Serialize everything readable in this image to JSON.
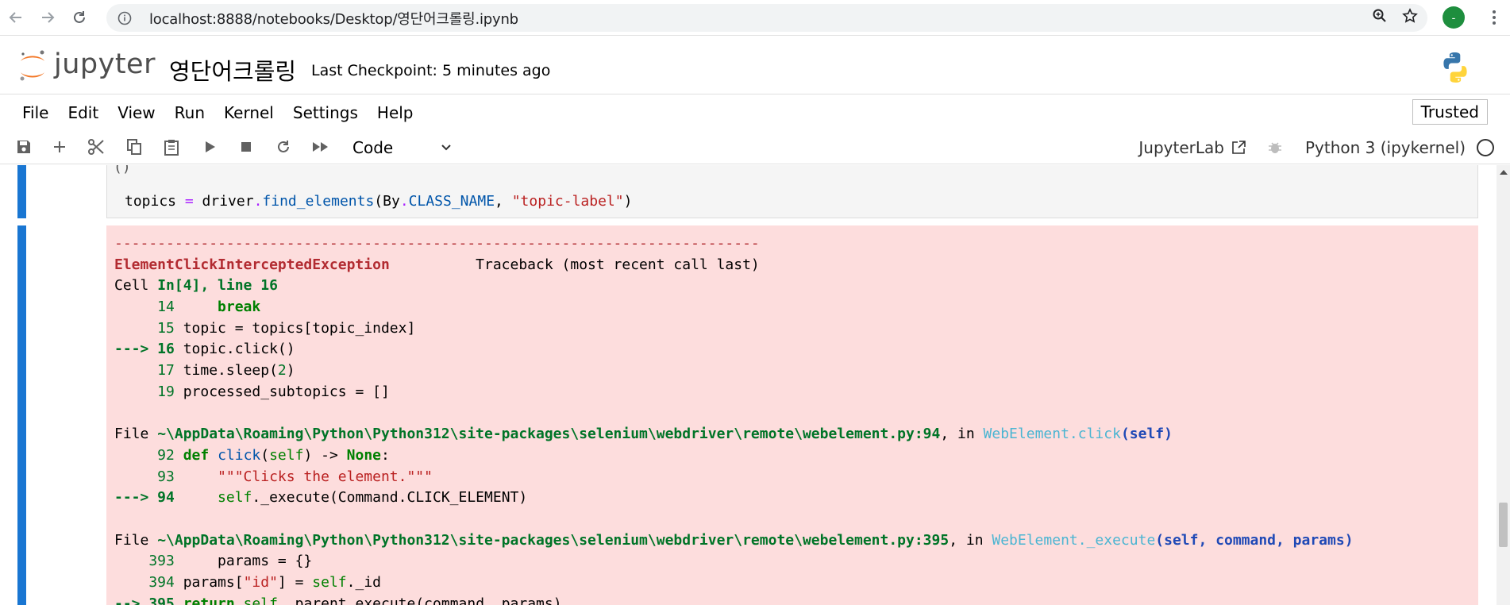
{
  "browser": {
    "url": "localhost:8888/notebooks/Desktop/영단어크롤링.ipynb",
    "profile_initial": "-",
    "icons": [
      "back-arrow-icon",
      "forward-arrow-icon",
      "reload-icon",
      "site-info-icon",
      "zoom-icon",
      "star-icon",
      "menu-icon"
    ]
  },
  "header": {
    "wordmark": "jupyter",
    "notebook_title": "영단어크롤링",
    "checkpoint": "Last Checkpoint: 5 minutes ago"
  },
  "menubar": {
    "items": [
      "File",
      "Edit",
      "View",
      "Run",
      "Kernel",
      "Settings",
      "Help"
    ],
    "trusted": "Trusted"
  },
  "toolbar": {
    "cell_type": "Code",
    "jupyterlab": "JupyterLab",
    "kernel": "Python 3 (ipykernel)",
    "icons": [
      "save-icon",
      "add-icon",
      "cut-icon",
      "copy-icon",
      "paste-icon",
      "run-icon",
      "stop-icon",
      "restart-icon",
      "fast-forward-icon"
    ]
  },
  "code_cell": {
    "partial_line": "     ()",
    "code_parts": [
      {
        "text": "topics ",
        "cls": ""
      },
      {
        "text": "=",
        "cls": "op"
      },
      {
        "text": " driver",
        "cls": ""
      },
      {
        "text": ".",
        "cls": "op"
      },
      {
        "text": "find_elements",
        "cls": "blue"
      },
      {
        "text": "(By",
        "cls": ""
      },
      {
        "text": ".",
        "cls": "op"
      },
      {
        "text": "CLASS_NAME",
        "cls": "blue"
      },
      {
        "text": ", ",
        "cls": ""
      },
      {
        "text": "\"topic-label\"",
        "cls": "str"
      },
      {
        "text": ")",
        "cls": ""
      }
    ]
  },
  "traceback": {
    "lines": [
      [
        {
          "t": "---------------------------------------------------------------------------",
          "c": "dashes"
        }
      ],
      [
        {
          "t": "ElementClickInterceptedException",
          "c": "red"
        },
        {
          "t": "          Traceback (most recent call last)",
          "c": ""
        }
      ],
      [
        {
          "t": "Cell ",
          "c": ""
        },
        {
          "t": "In[4], line 16",
          "c": "greenb"
        }
      ],
      [
        {
          "t": "     14",
          "c": "green"
        },
        {
          "t": "     ",
          "c": ""
        },
        {
          "t": "break",
          "c": "kw"
        }
      ],
      [
        {
          "t": "     15",
          "c": "green"
        },
        {
          "t": " topic ",
          "c": ""
        },
        {
          "t": "=",
          "c": ""
        },
        {
          "t": " topics[topic_index]",
          "c": ""
        }
      ],
      [
        {
          "t": "---> 16",
          "c": "greenb"
        },
        {
          "t": " topic",
          "c": ""
        },
        {
          "t": ".",
          "c": ""
        },
        {
          "t": "click()",
          "c": ""
        }
      ],
      [
        {
          "t": "     17",
          "c": "green"
        },
        {
          "t": " time",
          "c": ""
        },
        {
          "t": ".",
          "c": ""
        },
        {
          "t": "sleep(",
          "c": ""
        },
        {
          "t": "2",
          "c": "green"
        },
        {
          "t": ")",
          "c": ""
        }
      ],
      [
        {
          "t": "     19",
          "c": "green"
        },
        {
          "t": " processed_subtopics ",
          "c": ""
        },
        {
          "t": "=",
          "c": ""
        },
        {
          "t": " []",
          "c": ""
        }
      ],
      [
        {
          "t": "",
          "c": ""
        }
      ],
      [
        {
          "t": "File ",
          "c": ""
        },
        {
          "t": "~\\AppData\\Roaming\\Python\\Python312\\site-packages\\selenium\\webdriver\\remote\\webelement.py:94",
          "c": "greenb"
        },
        {
          "t": ", in ",
          "c": ""
        },
        {
          "t": "WebElement.click",
          "c": "cyan"
        },
        {
          "t": "(self)",
          "c": "blueb"
        }
      ],
      [
        {
          "t": "     92",
          "c": "green"
        },
        {
          "t": " ",
          "c": ""
        },
        {
          "t": "def",
          "c": "kw"
        },
        {
          "t": " ",
          "c": ""
        },
        {
          "t": "click",
          "c": "blue"
        },
        {
          "t": "(",
          "c": ""
        },
        {
          "t": "self",
          "c": "self"
        },
        {
          "t": ") ",
          "c": ""
        },
        {
          "t": "->",
          "c": ""
        },
        {
          "t": " ",
          "c": ""
        },
        {
          "t": "None",
          "c": "kw"
        },
        {
          "t": ":",
          "c": ""
        }
      ],
      [
        {
          "t": "     93",
          "c": "green"
        },
        {
          "t": "     ",
          "c": ""
        },
        {
          "t": "\"\"\"Clicks the element.\"\"\"",
          "c": "str"
        }
      ],
      [
        {
          "t": "---> 94",
          "c": "greenb"
        },
        {
          "t": "     ",
          "c": ""
        },
        {
          "t": "self",
          "c": "self"
        },
        {
          "t": ".",
          "c": ""
        },
        {
          "t": "_execute(Command",
          "c": ""
        },
        {
          "t": ".",
          "c": ""
        },
        {
          "t": "CLICK_ELEMENT)",
          "c": ""
        }
      ],
      [
        {
          "t": "",
          "c": ""
        }
      ],
      [
        {
          "t": "File ",
          "c": ""
        },
        {
          "t": "~\\AppData\\Roaming\\Python\\Python312\\site-packages\\selenium\\webdriver\\remote\\webelement.py:395",
          "c": "greenb"
        },
        {
          "t": ", in ",
          "c": ""
        },
        {
          "t": "WebElement._execute",
          "c": "cyan"
        },
        {
          "t": "(self, command, params)",
          "c": "blueb"
        }
      ],
      [
        {
          "t": "    393",
          "c": "green"
        },
        {
          "t": "     params ",
          "c": ""
        },
        {
          "t": "=",
          "c": ""
        },
        {
          "t": " {}",
          "c": ""
        }
      ],
      [
        {
          "t": "    394",
          "c": "green"
        },
        {
          "t": " params[",
          "c": ""
        },
        {
          "t": "\"id\"",
          "c": "str"
        },
        {
          "t": "] ",
          "c": ""
        },
        {
          "t": "=",
          "c": ""
        },
        {
          "t": " ",
          "c": ""
        },
        {
          "t": "self",
          "c": "self"
        },
        {
          "t": ".",
          "c": ""
        },
        {
          "t": "_id",
          "c": ""
        }
      ],
      [
        {
          "t": "--> 395",
          "c": "greenb"
        },
        {
          "t": " ",
          "c": ""
        },
        {
          "t": "return",
          "c": "kw"
        },
        {
          "t": " ",
          "c": ""
        },
        {
          "t": "self",
          "c": "self"
        },
        {
          "t": ".",
          "c": ""
        },
        {
          "t": "_parent",
          "c": ""
        },
        {
          "t": ".",
          "c": ""
        },
        {
          "t": "execute(command, params)",
          "c": ""
        }
      ]
    ]
  }
}
